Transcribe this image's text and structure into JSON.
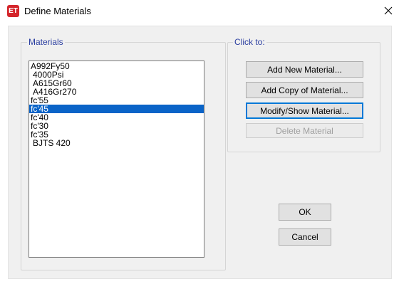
{
  "window": {
    "title": "Define Materials",
    "app_icon_text": "ET",
    "app_icon_color": "#d4252b",
    "close_glyph": "✕"
  },
  "materials_group": {
    "label": "Materials",
    "items": [
      {
        "label": "A992Fy50",
        "selected": false
      },
      {
        "label": "4000Psi",
        "selected": false
      },
      {
        "label": "A615Gr60",
        "selected": false
      },
      {
        "label": "A416Gr270",
        "selected": false
      },
      {
        "label": "fc'55",
        "selected": false
      },
      {
        "label": "fc'45",
        "selected": true
      },
      {
        "label": "fc'40",
        "selected": false
      },
      {
        "label": "fc'30",
        "selected": false
      },
      {
        "label": "fc'35",
        "selected": false
      },
      {
        "label": "BJTS 420",
        "selected": false
      }
    ]
  },
  "click_to_group": {
    "label": "Click to:",
    "add_new": "Add New Material...",
    "add_copy": "Add Copy of Material...",
    "modify_show": "Modify/Show Material...",
    "delete": "Delete Material"
  },
  "buttons": {
    "ok": "OK",
    "cancel": "Cancel"
  },
  "colors": {
    "selection": "#0a64c8",
    "group_label": "#2a3da0"
  }
}
